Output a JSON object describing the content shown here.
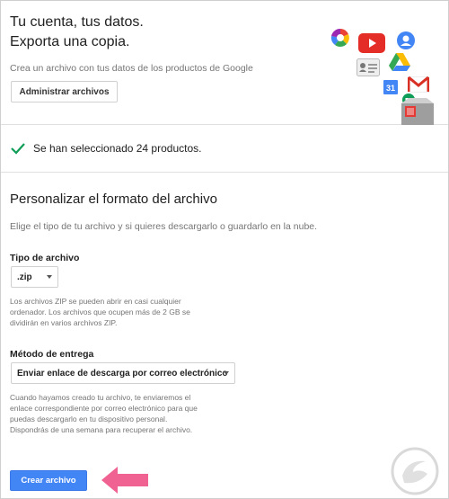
{
  "header": {
    "title_line1": "Tu cuenta, tus datos.",
    "title_line2": "Exporta una copia.",
    "subtitle": "Crea un archivo con tus datos de los productos de Google",
    "manage_button": "Administrar archivos",
    "product_icons": [
      "photos-icon",
      "youtube-icon",
      "contacts-icon",
      "drive-icon",
      "profile-card-icon",
      "gmail-icon",
      "calendar-icon",
      "hangouts-icon",
      "archive-box-icon"
    ],
    "calendar_icon_text": "31"
  },
  "selection": {
    "text": "Se han seleccionado 24 productos."
  },
  "format": {
    "title": "Personalizar el formato del archivo",
    "description": "Elige el tipo de tu archivo y si quieres descargarlo o guardarlo en la nube.",
    "file_type_label": "Tipo de archivo",
    "file_type_value": ".zip",
    "file_type_help": [
      "Los archivos ZIP se pueden abrir en casi cualquier",
      "ordenador. Los archivos que ocupen más de 2 GB se",
      "dividirán en varios archivos ZIP."
    ],
    "delivery_label": "Método de entrega",
    "delivery_value": "Enviar enlace de descarga por correo electrónico",
    "delivery_help": [
      "Cuando hayamos creado tu archivo, te enviaremos el",
      "enlace correspondiente por correo electrónico para que",
      "puedas descargarlo en tu dispositivo personal.",
      "Dispondrás de una semana para recuperar el archivo."
    ],
    "create_button": "Crear archivo"
  },
  "colors": {
    "accent_blue": "#4285f4",
    "check_green": "#0f9d58",
    "arrow_pink": "#f06292"
  }
}
